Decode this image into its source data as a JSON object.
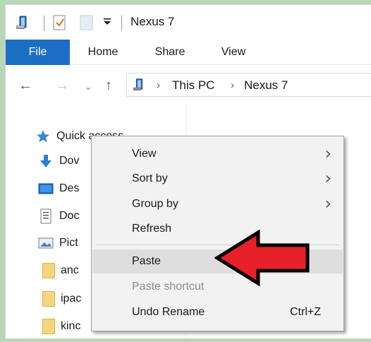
{
  "window": {
    "title": "Nexus 7"
  },
  "ribbon": {
    "tabs": [
      "File",
      "Home",
      "Share",
      "View"
    ]
  },
  "address": {
    "crumbs": [
      "This PC",
      "Nexus 7"
    ]
  },
  "nav_pane": {
    "items": [
      {
        "label": "Quick access",
        "icon": "star-icon"
      },
      {
        "label": "Dov",
        "icon": "download-arrow-icon"
      },
      {
        "label": "Des",
        "icon": "desktop-icon"
      },
      {
        "label": "Doc",
        "icon": "document-icon"
      },
      {
        "label": "Pict",
        "icon": "pictures-icon"
      },
      {
        "label": "anc",
        "icon": "folder-icon"
      },
      {
        "label": "ipac",
        "icon": "folder-icon"
      },
      {
        "label": "kinc",
        "icon": "folder-icon"
      }
    ]
  },
  "context_menu": {
    "items": [
      {
        "label": "View",
        "submenu": true
      },
      {
        "label": "Sort by",
        "submenu": true
      },
      {
        "label": "Group by",
        "submenu": true
      },
      {
        "label": "Refresh"
      },
      {
        "label": "Paste",
        "highlighted": true
      },
      {
        "label": "Paste shortcut",
        "disabled": true
      },
      {
        "label": "Undo Rename",
        "shortcut": "Ctrl+Z"
      }
    ]
  },
  "colors": {
    "file_tab": "#1c6ec4",
    "annotation_arrow": "#e8202a",
    "menu_bg": "#f2f2f2",
    "highlight": "#dedede"
  }
}
